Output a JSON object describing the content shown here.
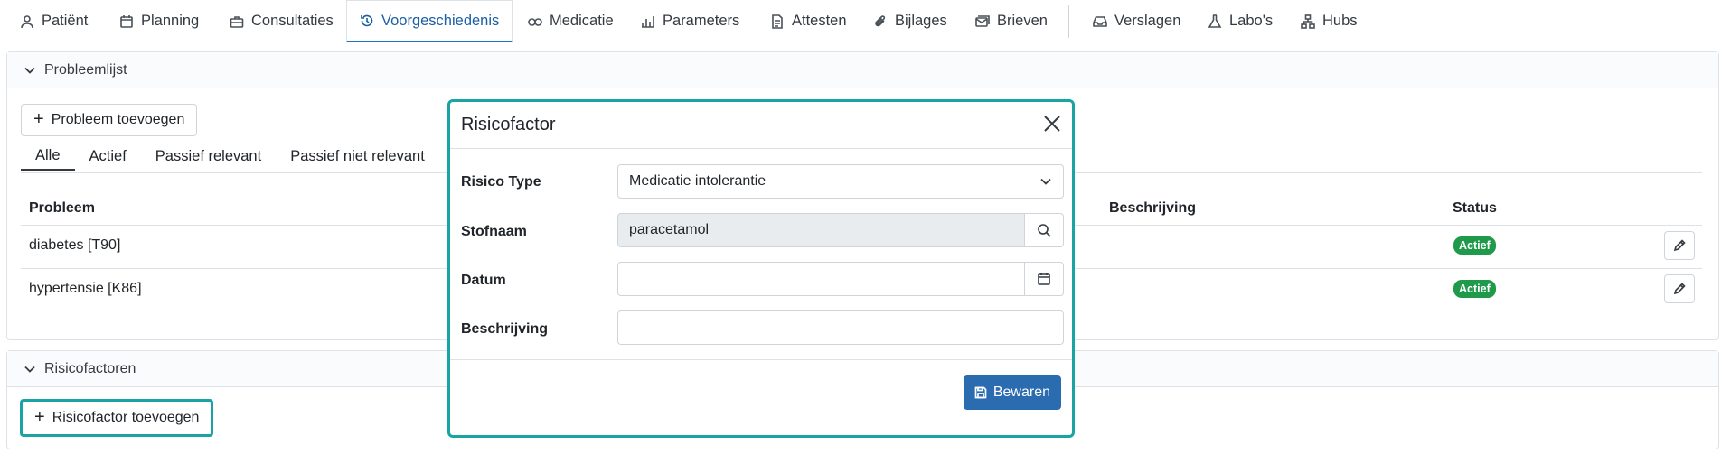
{
  "nav": {
    "tabs": [
      {
        "label": "Patiënt",
        "icon": "user-icon"
      },
      {
        "label": "Planning",
        "icon": "calendar-icon"
      },
      {
        "label": "Consultaties",
        "icon": "briefcase-icon"
      },
      {
        "label": "Voorgeschiedenis",
        "icon": "history-icon",
        "active": true
      },
      {
        "label": "Medicatie",
        "icon": "pills-icon"
      },
      {
        "label": "Parameters",
        "icon": "chart-icon"
      },
      {
        "label": "Attesten",
        "icon": "document-icon"
      },
      {
        "label": "Bijlages",
        "icon": "paperclip-icon"
      },
      {
        "label": "Brieven",
        "icon": "letters-icon"
      },
      {
        "label": "Verslagen",
        "icon": "inbox-icon"
      },
      {
        "label": "Labo's",
        "icon": "flask-icon"
      },
      {
        "label": "Hubs",
        "icon": "network-icon"
      }
    ]
  },
  "problems": {
    "header": "Probleemlijst",
    "add_button": "Probleem toevoegen",
    "subtabs": [
      "Alle",
      "Actief",
      "Passief relevant",
      "Passief niet relevant"
    ],
    "columns": {
      "problem": "Probleem",
      "description": "Beschrijving",
      "status": "Status"
    },
    "rows": [
      {
        "problem": "diabetes [T90]",
        "status": "Actief"
      },
      {
        "problem": "hypertensie [K86]",
        "status": "Actief"
      }
    ]
  },
  "risks": {
    "header": "Risicofactoren",
    "add_button": "Risicofactor toevoegen"
  },
  "modal": {
    "title": "Risicofactor",
    "fields": {
      "risk_type": {
        "label": "Risico Type",
        "value": "Medicatie intolerantie"
      },
      "substance": {
        "label": "Stofnaam",
        "value": "paracetamol"
      },
      "date": {
        "label": "Datum",
        "value": ""
      },
      "description": {
        "label": "Beschrijving",
        "value": ""
      }
    },
    "save_button": "Bewaren"
  },
  "colors": {
    "accent": "#1aa3a3",
    "primary": "#2b6cb0",
    "active_tab": "#1a5fa6",
    "badge_green": "#1e9a4a"
  }
}
